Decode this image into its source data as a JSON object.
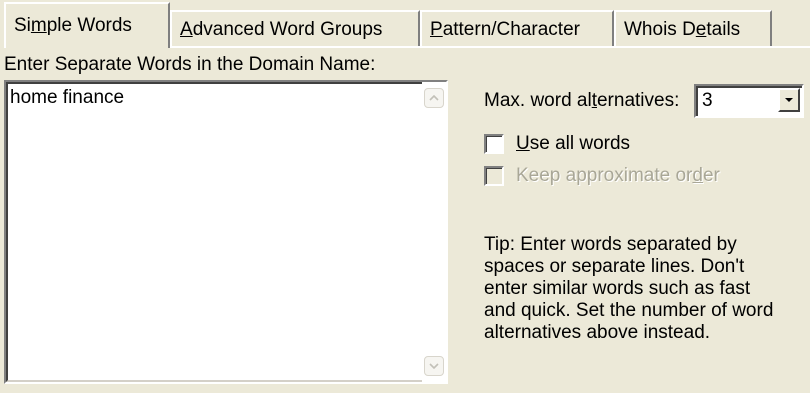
{
  "tabs": [
    {
      "label_pre": "Si",
      "mnemonic": "m",
      "label_post": "ple Words",
      "active": true
    },
    {
      "label_pre": "",
      "mnemonic": "A",
      "label_post": "dvanced Word Groups",
      "active": false
    },
    {
      "label_pre": "",
      "mnemonic": "P",
      "label_post": "attern/Character",
      "active": false
    },
    {
      "label_pre": "Whois D",
      "mnemonic": "e",
      "label_post": "tails",
      "active": false
    }
  ],
  "words_section": {
    "label": "Enter Separate Words in the Domain Name:",
    "value": "home finance"
  },
  "alternatives": {
    "label_pre": "Max. word al",
    "mnemonic": "t",
    "label_post": "ernatives:",
    "value": "3"
  },
  "options": {
    "use_all_words": {
      "label_pre": "",
      "mnemonic": "U",
      "label_post": "se all words",
      "checked": false,
      "enabled": true
    },
    "keep_order": {
      "label_pre": "Keep approximate or",
      "mnemonic": "d",
      "label_post": "er",
      "checked": false,
      "enabled": false
    }
  },
  "tip": {
    "lines": [
      "Tip: Enter words separated by",
      "spaces or separate lines. Don't",
      "enter similar words such as fast",
      "and quick. Set the number of word",
      "alternatives above instead."
    ]
  },
  "icons": {
    "scroll_up": "scroll-up-arrow-icon",
    "scroll_down": "scroll-down-arrow-icon",
    "dropdown": "dropdown-arrow-icon"
  },
  "colors": {
    "dialog_bg": "#ECE9D8",
    "disabled_text": "#A9A797"
  }
}
